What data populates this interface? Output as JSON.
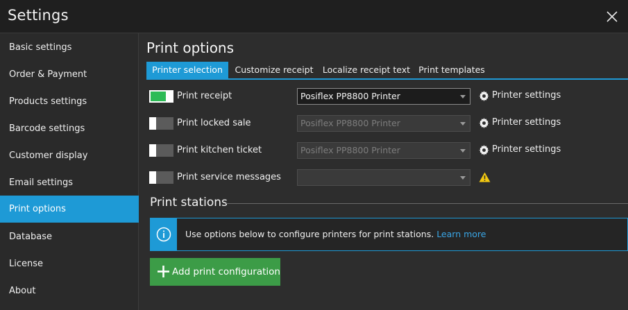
{
  "window": {
    "title": "Settings",
    "close_icon": "close-icon"
  },
  "sidebar": {
    "items": [
      {
        "label": "Basic settings",
        "active": false
      },
      {
        "label": "Order & Payment",
        "active": false
      },
      {
        "label": "Products settings",
        "active": false
      },
      {
        "label": "Barcode settings",
        "active": false
      },
      {
        "label": "Customer display",
        "active": false
      },
      {
        "label": "Email settings",
        "active": false
      },
      {
        "label": "Print options",
        "active": true
      },
      {
        "label": "Database",
        "active": false
      },
      {
        "label": "License",
        "active": false
      },
      {
        "label": "About",
        "active": false
      }
    ]
  },
  "main": {
    "title": "Print options",
    "tabs": [
      {
        "label": "Printer selection",
        "active": true
      },
      {
        "label": "Customize receipt",
        "active": false
      },
      {
        "label": "Localize receipt text",
        "active": false
      },
      {
        "label": "Print templates",
        "active": false
      }
    ],
    "rows": [
      {
        "label": "Print receipt",
        "enabled": true,
        "printer": "Posiflex PP8800 Printer",
        "settings_label": "Printer settings"
      },
      {
        "label": "Print locked sale",
        "enabled": false,
        "printer": "Posiflex PP8800 Printer",
        "settings_label": "Printer settings"
      },
      {
        "label": "Print kitchen ticket",
        "enabled": false,
        "printer": "Posiflex PP8800 Printer",
        "settings_label": "Printer settings"
      },
      {
        "label": "Print service messages",
        "enabled": false,
        "printer": "",
        "settings_label": ""
      }
    ],
    "print_stations": {
      "title": "Print stations",
      "info_text": "Use options below to configure printers for print stations.",
      "info_link": "Learn more",
      "add_button": "Add print configuration"
    }
  },
  "colors": {
    "accent": "#1e9ad6",
    "toggle_on": "#2dbb56",
    "add_button": "#3c9c47",
    "warning": "#f2c811"
  }
}
